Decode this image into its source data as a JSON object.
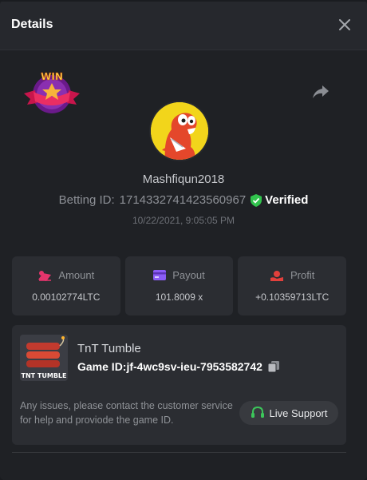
{
  "header": {
    "title": "Details",
    "close_icon": "close-icon"
  },
  "bet": {
    "badge_text": "WIN",
    "username": "Mashfiqun2018",
    "betting_id_label": "Betting ID:",
    "betting_id": "1714332741423560967",
    "verified_label": "Verified",
    "datetime": "10/22/2021, 9:05:05 PM"
  },
  "stats": {
    "amount": {
      "label": "Amount",
      "value": "0.00102774LTC",
      "icon": "coins-icon"
    },
    "payout": {
      "label": "Payout",
      "value": "101.8009 x",
      "icon": "card-icon"
    },
    "profit": {
      "label": "Profit",
      "value": "+0.10359713LTC",
      "icon": "profit-icon"
    }
  },
  "game": {
    "name": "TnT Tumble",
    "thumb_text": "TNT TUMBLE",
    "id_label": "Game ID:",
    "id_value": "jf-4wc9sv-ieu-7953582742",
    "issue_text": "Any issues, please contact the customer service for help and proviode the game ID.",
    "support_label": "Live Support"
  },
  "colors": {
    "verified_green": "#31c34d",
    "amount_icon": "#e4356c",
    "payout_icon": "#8b5cf6",
    "profit_icon": "#e2403c",
    "support_icon": "#3cc55a"
  }
}
